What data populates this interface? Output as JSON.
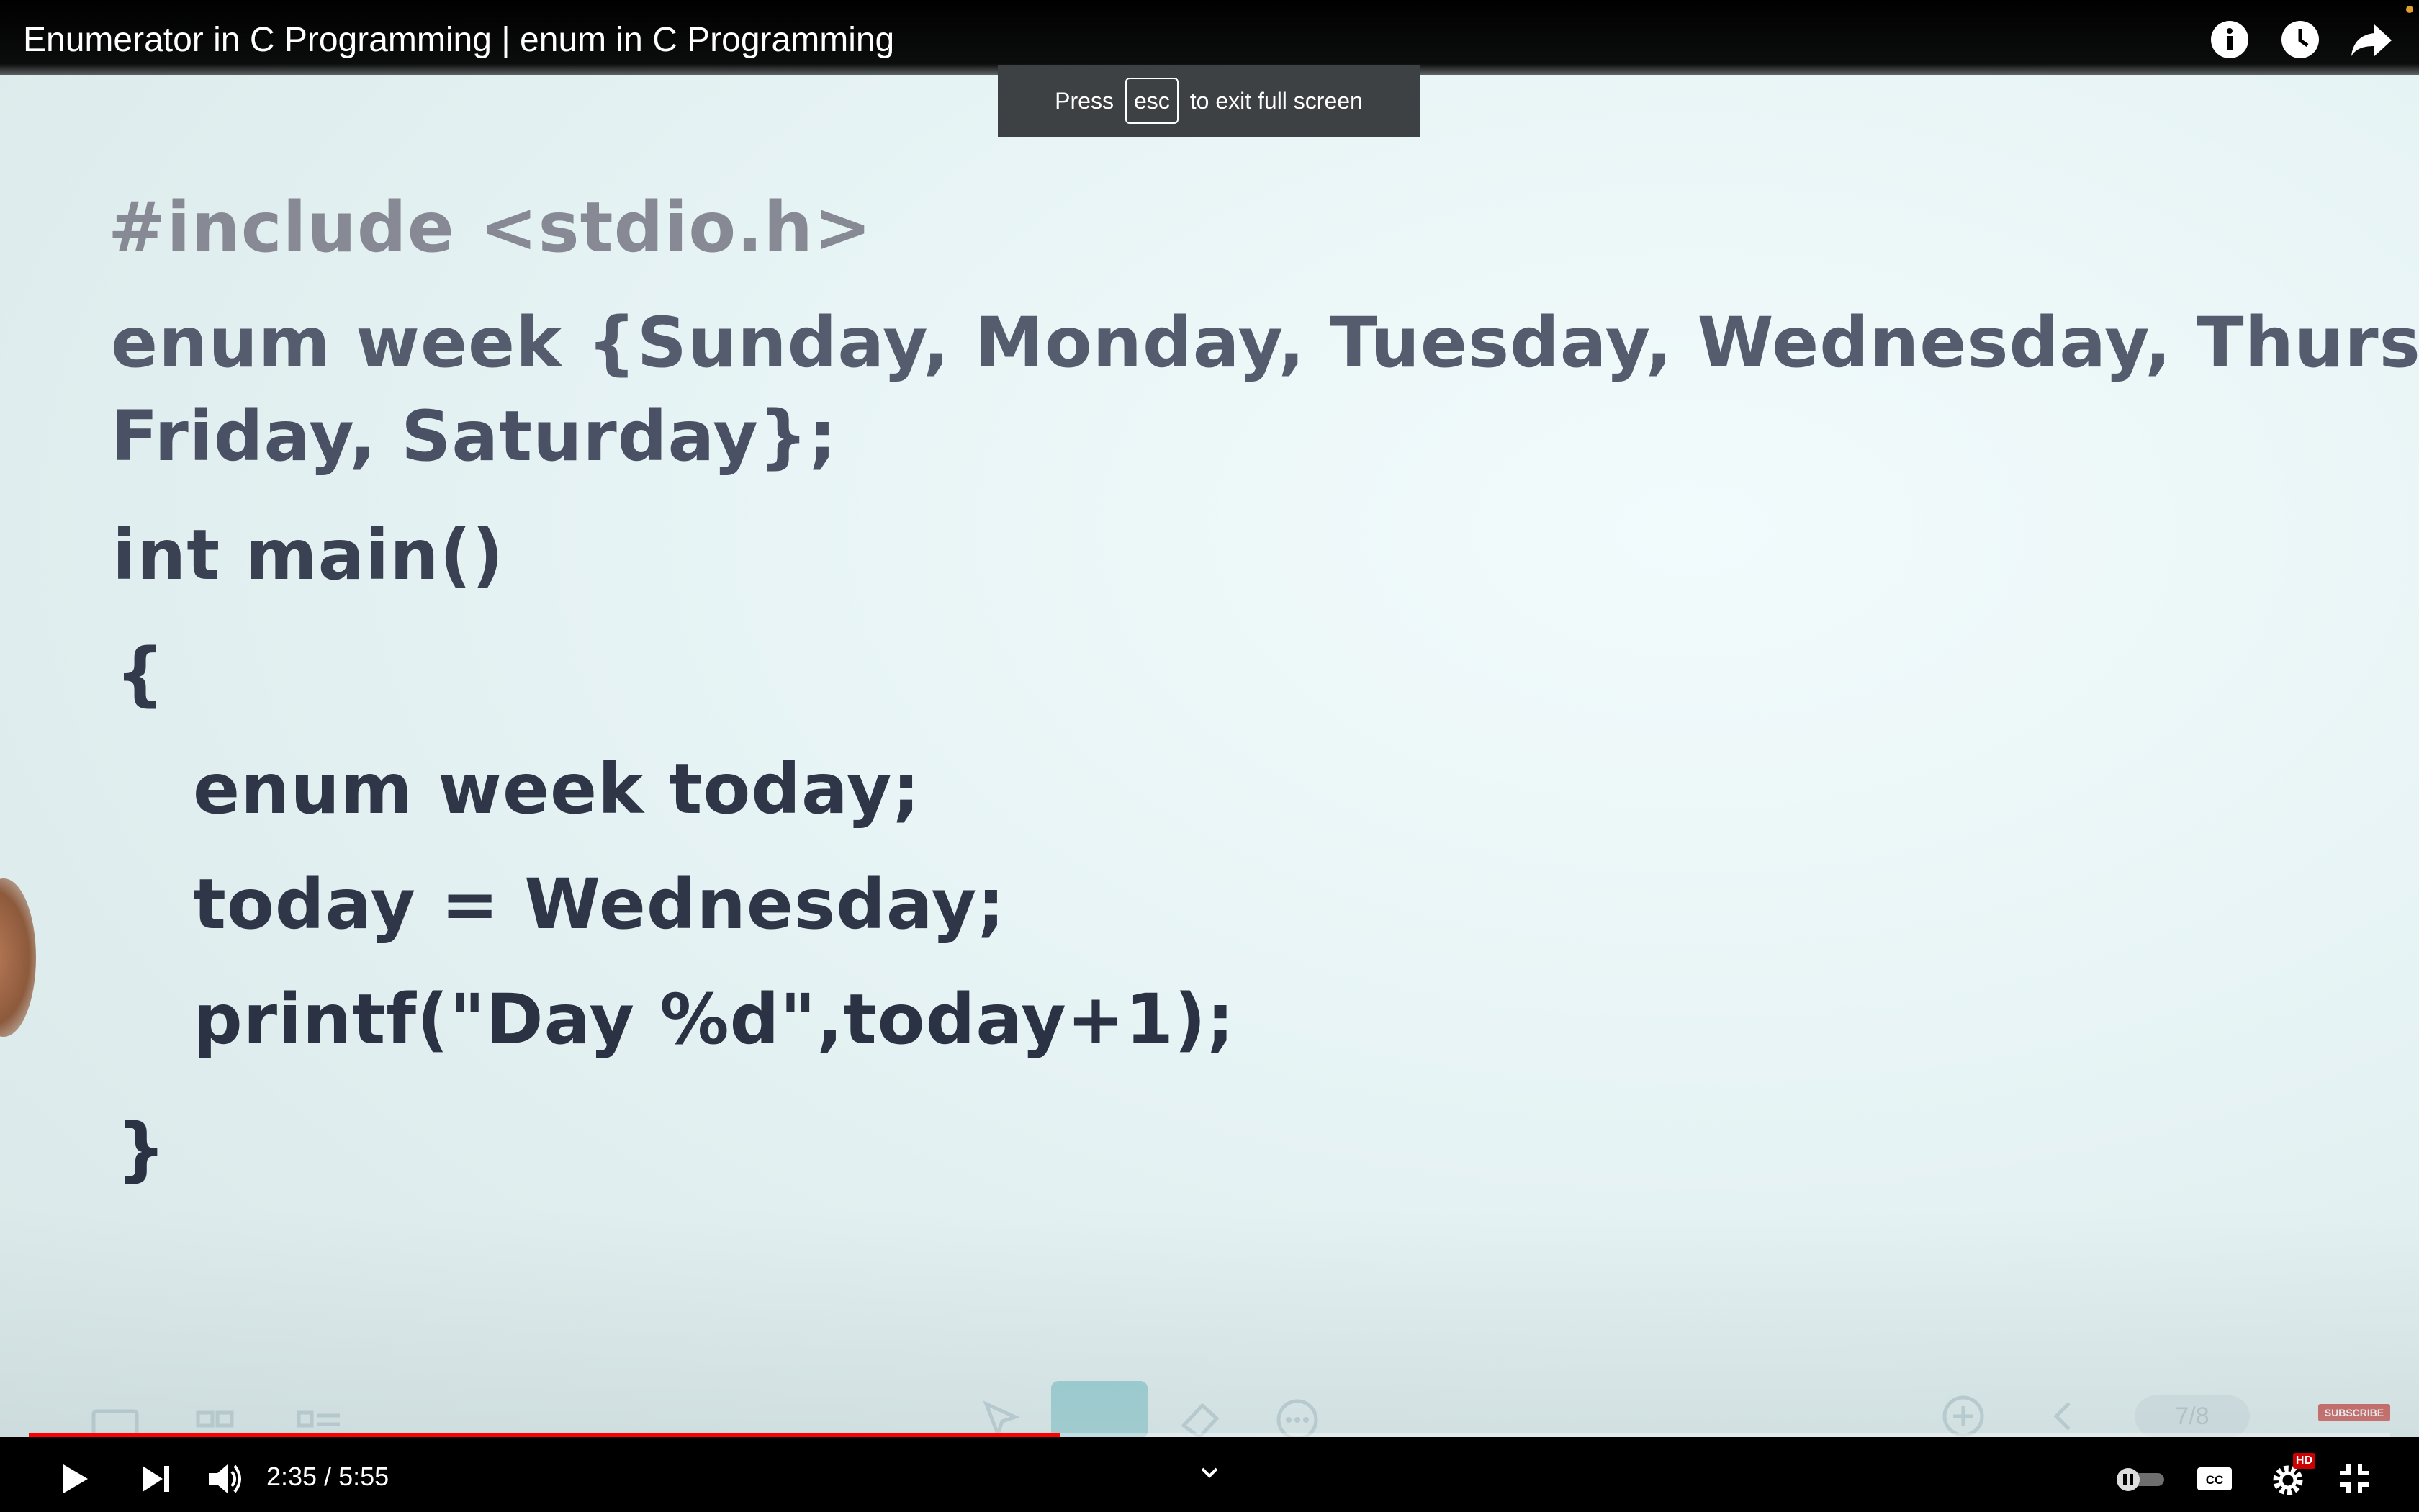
{
  "video": {
    "title": "Enumerator in C Programming | enum in C Programming",
    "code_lines": {
      "include": "#include <stdio.h>",
      "enum_decl_1": "enum week {Sunday, Monday, Tuesday, Wednesday, Thursday,",
      "enum_decl_2": "Friday, Saturday};",
      "main": "int main()",
      "open_brace": "{",
      "declare_today": "enum week today;",
      "assign_today": "today = Wednesday;",
      "printf": "printf(\"Day %d\",today+1);",
      "close_brace": "}"
    },
    "whiteboard": {
      "page_indicator": "7/8",
      "subscribe_label": "SUBSCRIBE"
    }
  },
  "fullscreen_toast": {
    "prefix": "Press",
    "key": "esc",
    "suffix": "to exit full screen"
  },
  "top_icons": [
    "info-icon",
    "watch-later-icon",
    "share-icon"
  ],
  "player": {
    "current_time": "2:35",
    "separator": "/",
    "duration": "5:55",
    "progress_fraction": 0.4366,
    "hd_badge": "HD",
    "accent_color": "#ff0000"
  }
}
